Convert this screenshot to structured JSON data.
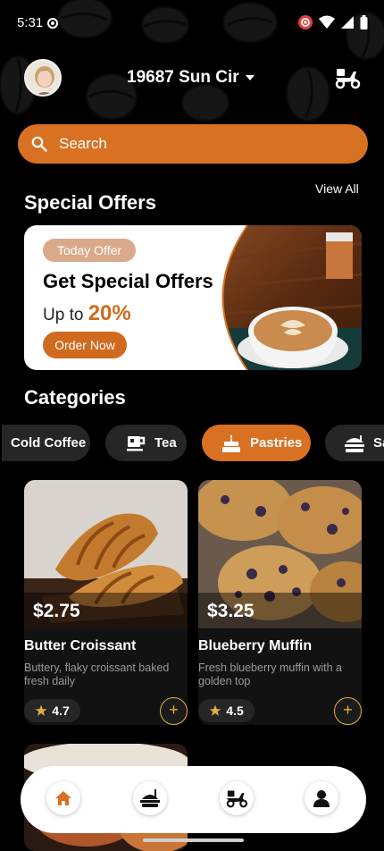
{
  "status_bar": {
    "time": "5:31"
  },
  "header": {
    "location": "19687 Sun Cir"
  },
  "search": {
    "placeholder": "Search"
  },
  "special_offers": {
    "title": "Special Offers",
    "view_all": "View All",
    "card": {
      "badge": "Today Offer",
      "title": "Get Special Offers",
      "subtitle_prefix": "Up to",
      "discount": "20%",
      "button": "Order Now"
    }
  },
  "categories": {
    "title": "Categories",
    "items": [
      {
        "label": "Cold Coffee",
        "icon": "cold-coffee-icon",
        "active": false
      },
      {
        "label": "Tea",
        "icon": "tea-cup-icon",
        "active": false
      },
      {
        "label": "Pastries",
        "icon": "cake-icon",
        "active": true
      },
      {
        "label": "Sa",
        "icon": "sandwich-icon",
        "active": false
      }
    ]
  },
  "products": [
    {
      "price": "$2.75",
      "name": "Butter Croissant",
      "description": "Buttery, flaky croissant baked fresh daily",
      "rating": "4.7"
    },
    {
      "price": "$3.25",
      "name": "Blueberry Muffin",
      "description": "Fresh blueberry muffin with a golden top",
      "rating": "4.5"
    }
  ],
  "bottom_nav": [
    {
      "icon": "home-icon",
      "active": true
    },
    {
      "icon": "food-order-icon",
      "active": false
    },
    {
      "icon": "scooter-delivery-icon",
      "active": false
    },
    {
      "icon": "profile-icon",
      "active": false
    }
  ],
  "colors": {
    "accent": "#d87122",
    "background": "#000000",
    "card": "#121212",
    "chip": "#262626",
    "star": "#e3b13a"
  }
}
